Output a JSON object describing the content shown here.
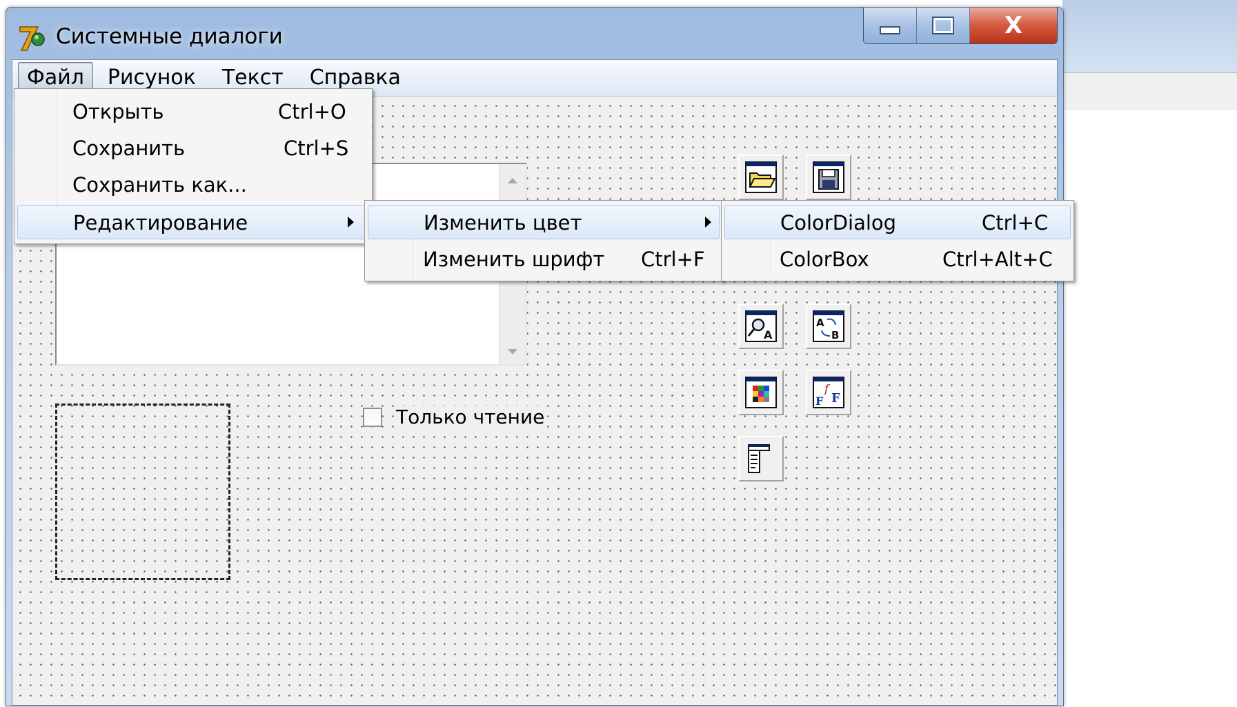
{
  "window": {
    "title": "Системные диалоги",
    "close_glyph": "X"
  },
  "menubar": {
    "items": [
      "Файл",
      "Рисунок",
      "Текст",
      "Справка"
    ]
  },
  "file_menu": {
    "items": [
      {
        "label": "Открыть",
        "shortcut": "Ctrl+O"
      },
      {
        "label": "Сохранить",
        "shortcut": "Ctrl+S"
      },
      {
        "label": "Сохранить как...",
        "shortcut": ""
      },
      {
        "label": "Редактирование",
        "shortcut": ""
      }
    ]
  },
  "edit_submenu": {
    "items": [
      {
        "label": "Изменить цвет",
        "shortcut": ""
      },
      {
        "label": "Изменить шрифт",
        "shortcut": "Ctrl+F"
      }
    ]
  },
  "color_submenu": {
    "items": [
      {
        "label": "ColorDialog",
        "shortcut": "Ctrl+C"
      },
      {
        "label": "ColorBox",
        "shortcut": "Ctrl+Alt+C"
      }
    ]
  },
  "form": {
    "readonly_checkbox_label": "Только чтение",
    "readonly_checked": false
  },
  "toolbox": {
    "icons": [
      "open-dialog-icon",
      "save-dialog-icon",
      "find-dialog-icon",
      "replace-dialog-icon",
      "color-dialog-icon",
      "font-dialog-icon",
      "page-setup-dialog-icon"
    ],
    "replace_icon_text_top": "A",
    "replace_icon_text_bottom": "B",
    "find_icon_text": "A",
    "font_icon_text_left": "F",
    "font_icon_text_mid": "f",
    "font_icon_text_right": "F"
  }
}
